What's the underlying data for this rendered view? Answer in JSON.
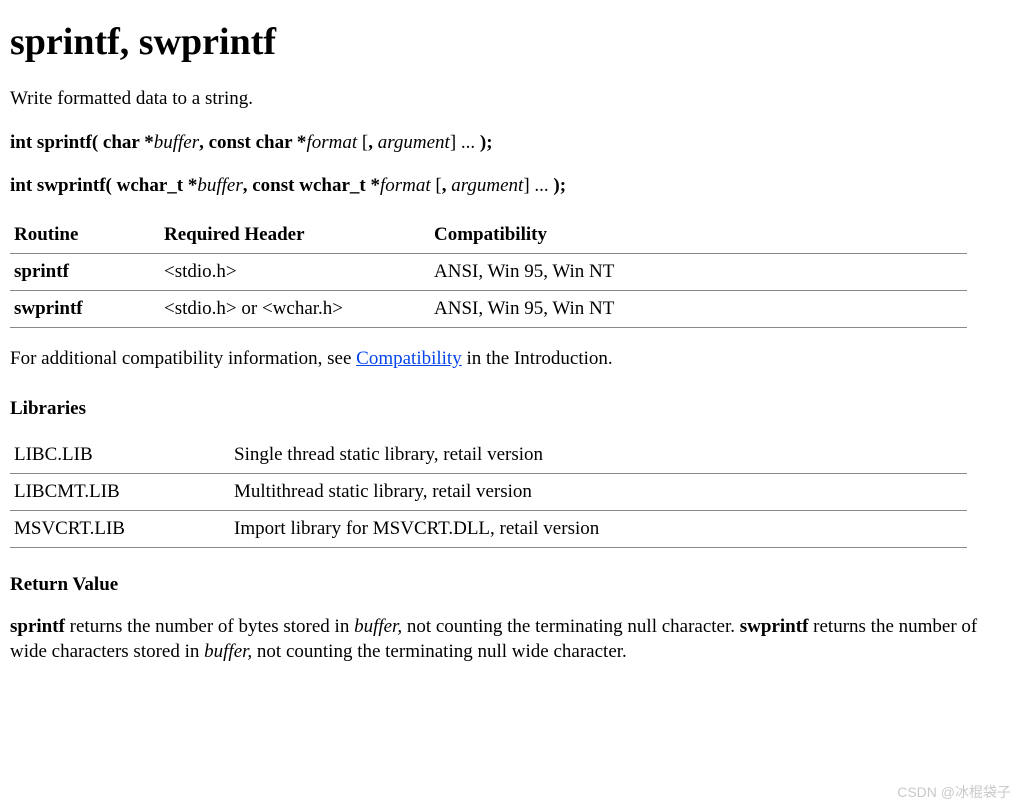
{
  "title": "sprintf, swprintf",
  "intro": "Write formatted data to a string.",
  "sig1": {
    "p1": "int sprintf( char *",
    "i1": "buffer",
    "p2": ", const char *",
    "i2": "format",
    "b1": " [",
    "p3": ", ",
    "i3": "argument",
    "b2": "] ... ",
    "p4": ");"
  },
  "sig2": {
    "p1": "int swprintf( wchar_t *",
    "i1": "buffer",
    "p2": ", const wchar_t *",
    "i2": "format",
    "b1": " [",
    "p3": ", ",
    "i3": "argument",
    "b2": "] ... ",
    "p4": ");"
  },
  "compat_table": {
    "h1": "Routine",
    "h2": "Required Header",
    "h3": "Compatibility",
    "r1": {
      "c1": "sprintf",
      "c2": "<stdio.h>",
      "c3": "ANSI, Win 95, Win NT"
    },
    "r2": {
      "c1": "swprintf",
      "c2": "<stdio.h> or <wchar.h>",
      "c3": "ANSI, Win 95, Win NT"
    }
  },
  "compat_note": {
    "pre": "For additional compatibility information, see ",
    "link": "Compatibility",
    "post": " in the Introduction."
  },
  "libs_heading": "Libraries",
  "libs": {
    "r1": {
      "c1": "LIBC.LIB",
      "c2": "Single thread static library, retail version"
    },
    "r2": {
      "c1": "LIBCMT.LIB",
      "c2": "Multithread static library, retail version"
    },
    "r3": {
      "c1": "MSVCRT.LIB",
      "c2": "Import library for MSVCRT.DLL, retail version"
    }
  },
  "retval_heading": "Return Value",
  "ret1": {
    "b1": "sprintf",
    "t1": " returns the number of bytes stored in ",
    "i1": "buffer,",
    "t2": " not counting the terminating null character. "
  },
  "ret2": {
    "b1": "swprintf",
    "t1": " returns the number of wide characters stored in ",
    "i1": "buffer,",
    "t2": " not counting the terminating null wide character."
  },
  "watermark": "CSDN @冰棍袋子"
}
